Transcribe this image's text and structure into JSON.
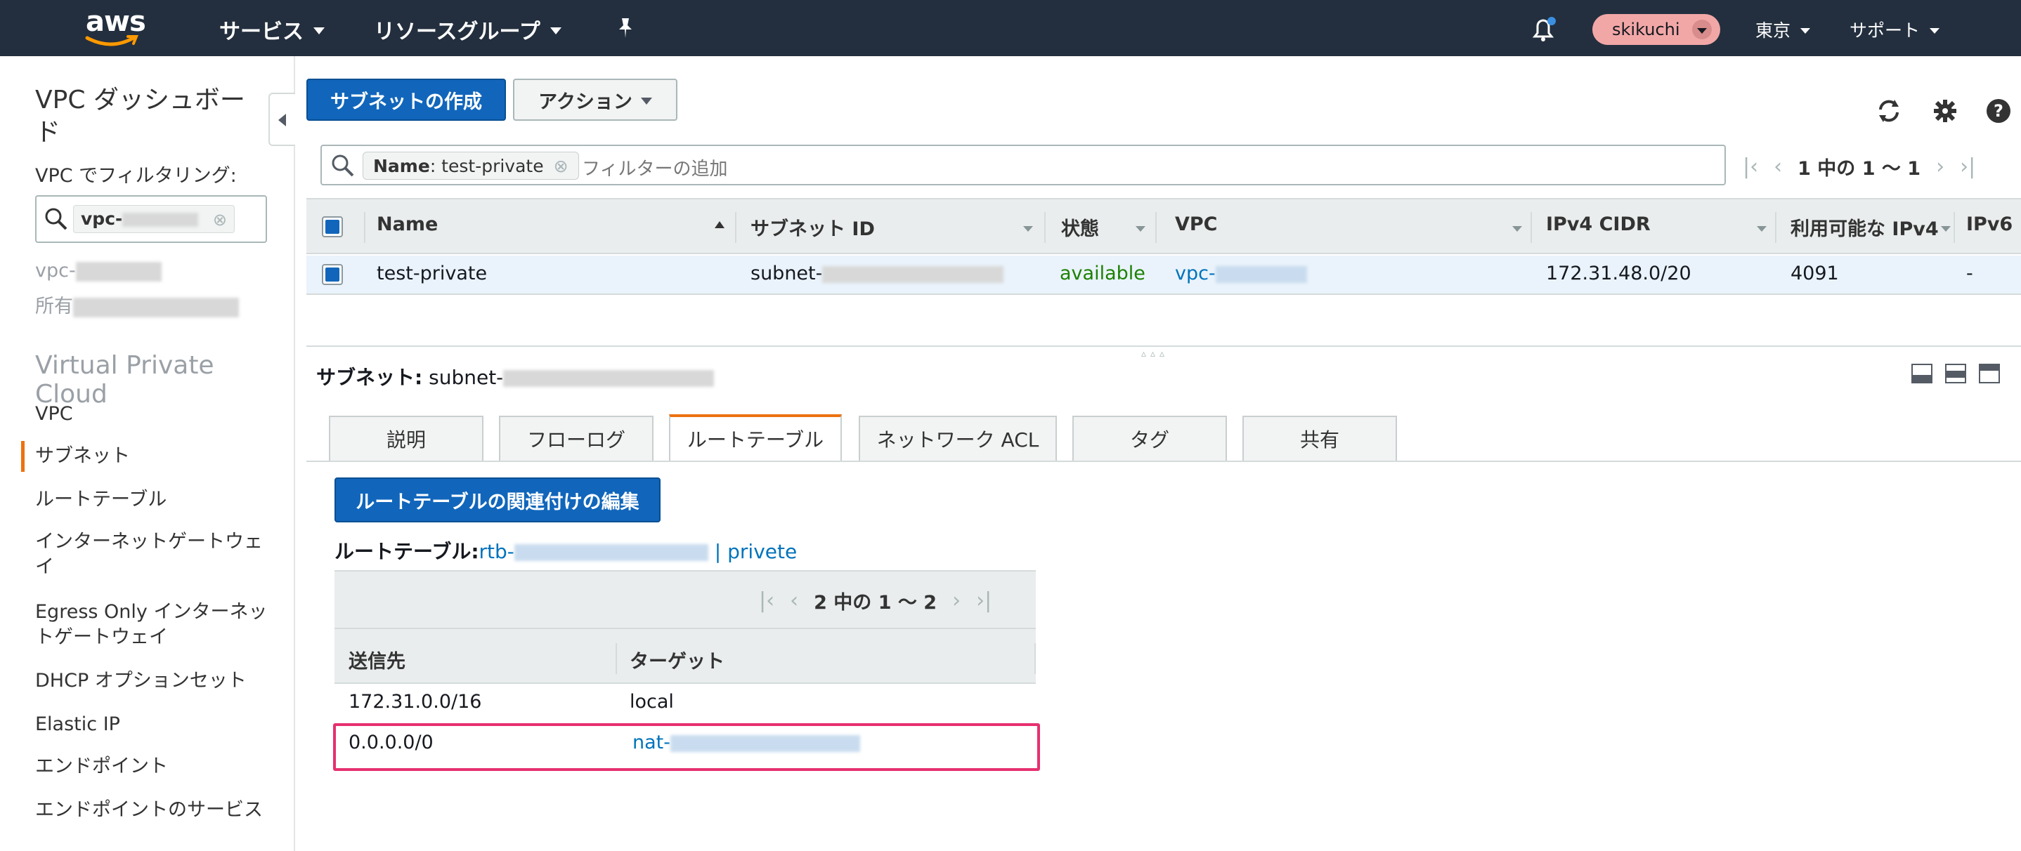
{
  "topbar": {
    "logo": "aws",
    "services": "サービス",
    "resource_groups": "リソースグループ",
    "pin_icon": "pin-icon",
    "bell_icon": "bell-icon",
    "user": "skikuchi",
    "region": "東京",
    "support": "サポート"
  },
  "sidebar": {
    "title": "VPC ダッシュボード",
    "filter_label": "VPC でフィルタリング:",
    "filter_value": "vpc-",
    "vpc_line": "vpc-",
    "owner_line": "所有",
    "section": "Virtual Private Cloud",
    "items": [
      "VPC",
      "サブネット",
      "ルートテーブル",
      "インターネットゲートウェイ",
      "Egress Only インターネットゲートウェイ",
      "DHCP オプションセット",
      "Elastic IP",
      "エンドポイント",
      "エンドポイントのサービス"
    ],
    "active_index": 1
  },
  "toolbar": {
    "create_subnet": "サブネットの作成",
    "actions": "アクション"
  },
  "filter": {
    "chip_key": "Name",
    "chip_value": " : test-private",
    "placeholder": "フィルターの追加",
    "pager": "1 中の 1 〜 1"
  },
  "table": {
    "columns": [
      "Name",
      "サブネット ID",
      "状態",
      "VPC",
      "IPv4 CIDR",
      "利用可能な IPv4",
      "IPv6"
    ],
    "row": {
      "name": "test-private",
      "subnet_id": "subnet-",
      "state": "available",
      "vpc": "vpc-",
      "cidr": "172.31.48.0/20",
      "available": "4091",
      "ipv6": "-"
    }
  },
  "detail": {
    "label": "サブネット:",
    "subnet": "subnet-",
    "tabs": [
      "説明",
      "フローログ",
      "ルートテーブル",
      "ネットワーク ACL",
      "タグ",
      "共有"
    ],
    "active_tab": 2,
    "edit_button": "ルートテーブルの関連付けの編集",
    "rt_label": "ルートテーブル:",
    "rt_id": "rtb-",
    "rt_name": " | privete",
    "pager": "2 中の 1 〜 2",
    "columns": [
      "送信先",
      "ターゲット"
    ],
    "routes": [
      {
        "dest": "172.31.0.0/16",
        "target": "local",
        "link": false
      },
      {
        "dest": "0.0.0.0/0",
        "target": "nat-",
        "link": true
      }
    ]
  },
  "colors": {
    "topbar": "#232f3e",
    "primary": "#1166bb",
    "accent": "#ec7211",
    "link": "#0073bb",
    "available": "#1d8102",
    "highlight": "#e6306f"
  }
}
